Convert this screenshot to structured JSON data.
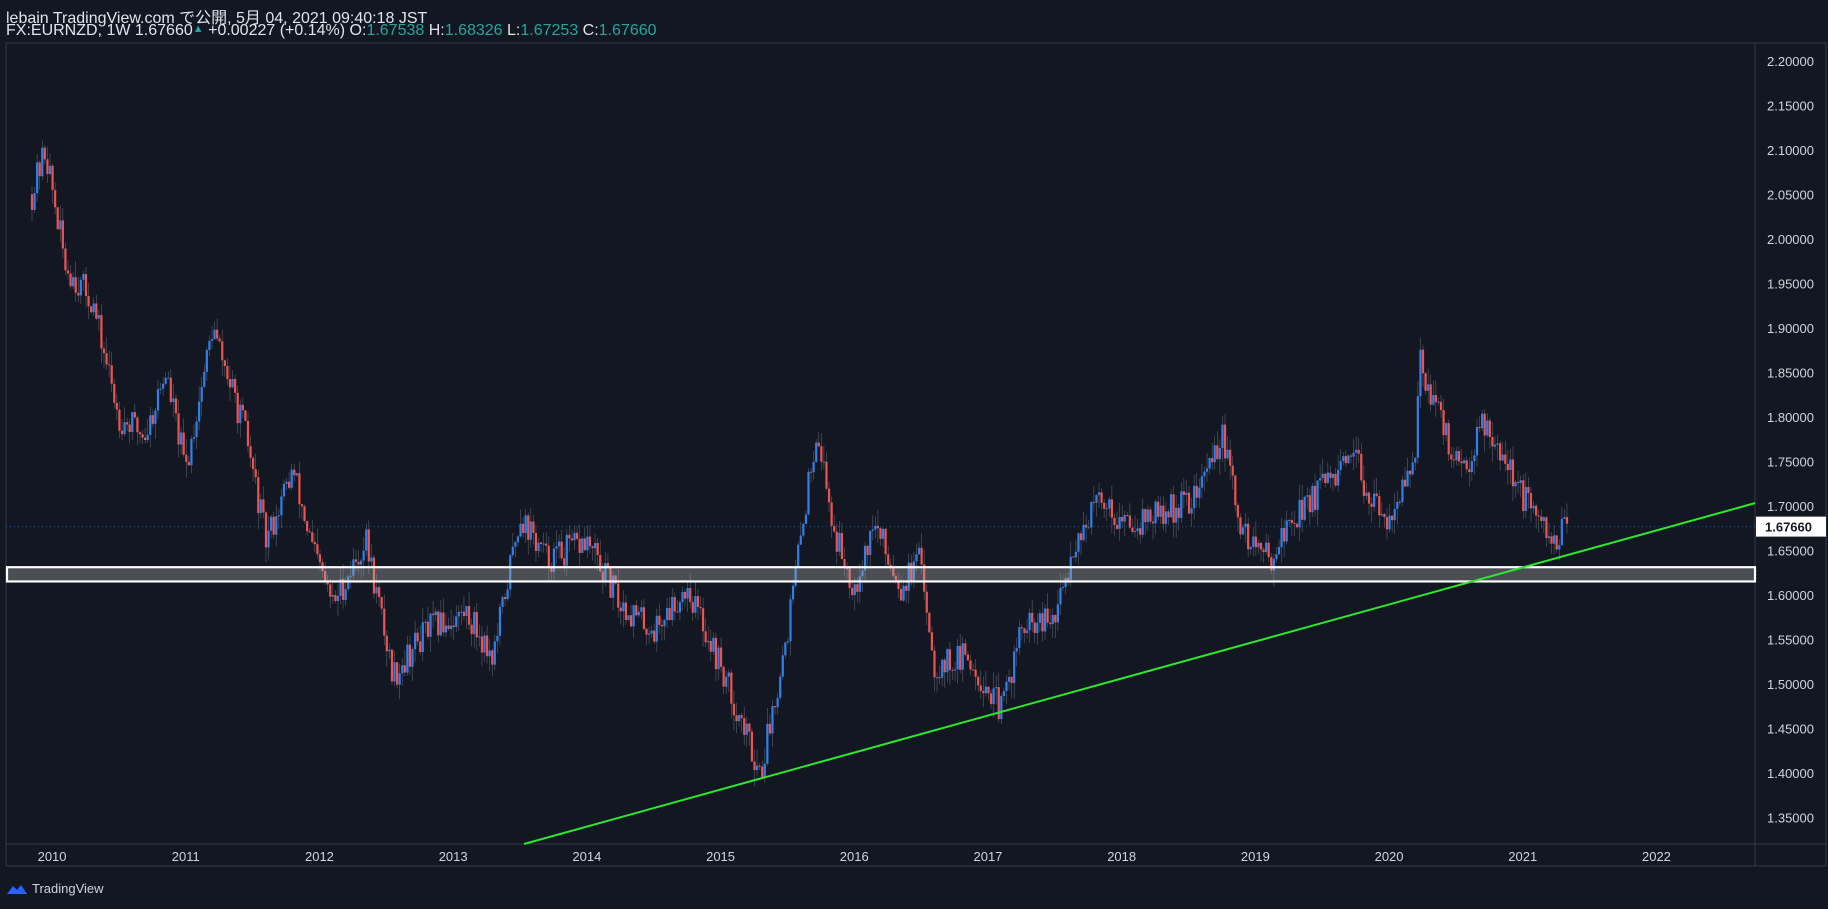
{
  "header": {
    "line1": "lebain TradingView.com で公開, 5月 04, 2021 09:40:18 JST",
    "symbol": "FX:EURNZD, 1W",
    "last": "1.67660",
    "change": "+0.00227 (+0.14%)",
    "o_label": "O:",
    "o_val": "1.67538",
    "h_label": "H:",
    "h_val": "1.68326",
    "l_label": "L:",
    "l_val": "1.67253",
    "c_label": "C:",
    "c_val": "1.67660"
  },
  "footer": {
    "brand": "TradingView",
    "icon": "tradingview-logo-icon"
  },
  "colors": {
    "background": "#131722",
    "up": "#2f80ed",
    "down": "#ef5350",
    "support_band": "#ffffff",
    "trendline": "#2ee62e",
    "axis_text": "#d1d4dc",
    "price_label_bg": "#ffffff"
  },
  "chart_data": {
    "type": "candlestick",
    "title": "FX:EURNZD, 1W",
    "x_axis": {
      "labels": [
        "2010",
        "2011",
        "2012",
        "2013",
        "2014",
        "2015",
        "2016",
        "2017",
        "2018",
        "2019",
        "2020",
        "2021",
        "2022"
      ]
    },
    "y_axis": {
      "ylim": [
        1.32,
        2.22
      ],
      "ticks": [
        "2.20000",
        "2.15000",
        "2.10000",
        "2.05000",
        "2.00000",
        "1.95000",
        "1.90000",
        "1.85000",
        "1.80000",
        "1.75000",
        "1.70000",
        "1.65000",
        "1.60000",
        "1.55000",
        "1.50000",
        "1.45000",
        "1.40000",
        "1.35000"
      ],
      "last_price_label": "1.67660"
    },
    "price_path": [
      [
        2009.85,
        2.05
      ],
      [
        2009.95,
        2.1
      ],
      [
        2010.1,
        1.97
      ],
      [
        2010.3,
        1.93
      ],
      [
        2010.5,
        1.8
      ],
      [
        2010.7,
        1.78
      ],
      [
        2010.85,
        1.85
      ],
      [
        2011.0,
        1.74
      ],
      [
        2011.2,
        1.9
      ],
      [
        2011.45,
        1.78
      ],
      [
        2011.6,
        1.66
      ],
      [
        2011.8,
        1.74
      ],
      [
        2011.95,
        1.65
      ],
      [
        2012.1,
        1.59
      ],
      [
        2012.35,
        1.66
      ],
      [
        2012.55,
        1.51
      ],
      [
        2012.8,
        1.56
      ],
      [
        2013.1,
        1.58
      ],
      [
        2013.3,
        1.53
      ],
      [
        2013.5,
        1.69
      ],
      [
        2013.7,
        1.64
      ],
      [
        2014.0,
        1.66
      ],
      [
        2014.25,
        1.59
      ],
      [
        2014.5,
        1.56
      ],
      [
        2014.75,
        1.61
      ],
      [
        2015.0,
        1.52
      ],
      [
        2015.3,
        1.4
      ],
      [
        2015.5,
        1.56
      ],
      [
        2015.72,
        1.79
      ],
      [
        2015.85,
        1.67
      ],
      [
        2016.0,
        1.61
      ],
      [
        2016.15,
        1.68
      ],
      [
        2016.35,
        1.61
      ],
      [
        2016.5,
        1.64
      ],
      [
        2016.6,
        1.52
      ],
      [
        2016.85,
        1.53
      ],
      [
        2017.1,
        1.47
      ],
      [
        2017.25,
        1.56
      ],
      [
        2017.5,
        1.57
      ],
      [
        2017.65,
        1.66
      ],
      [
        2017.85,
        1.71
      ],
      [
        2018.0,
        1.68
      ],
      [
        2018.3,
        1.69
      ],
      [
        2018.55,
        1.71
      ],
      [
        2018.75,
        1.78
      ],
      [
        2018.9,
        1.67
      ],
      [
        2019.1,
        1.64
      ],
      [
        2019.3,
        1.69
      ],
      [
        2019.5,
        1.72
      ],
      [
        2019.75,
        1.75
      ],
      [
        2019.95,
        1.68
      ],
      [
        2020.2,
        1.74
      ],
      [
        2020.22,
        1.87
      ],
      [
        2020.35,
        1.81
      ],
      [
        2020.55,
        1.73
      ],
      [
        2020.7,
        1.8
      ],
      [
        2020.85,
        1.76
      ],
      [
        2021.0,
        1.71
      ],
      [
        2021.2,
        1.66
      ],
      [
        2021.34,
        1.676
      ]
    ],
    "support_zone": [
      1.615,
      1.631
    ],
    "trendline": {
      "from": [
        2013.53,
        1.32
      ],
      "to": [
        2022.9,
        1.703
      ]
    }
  }
}
